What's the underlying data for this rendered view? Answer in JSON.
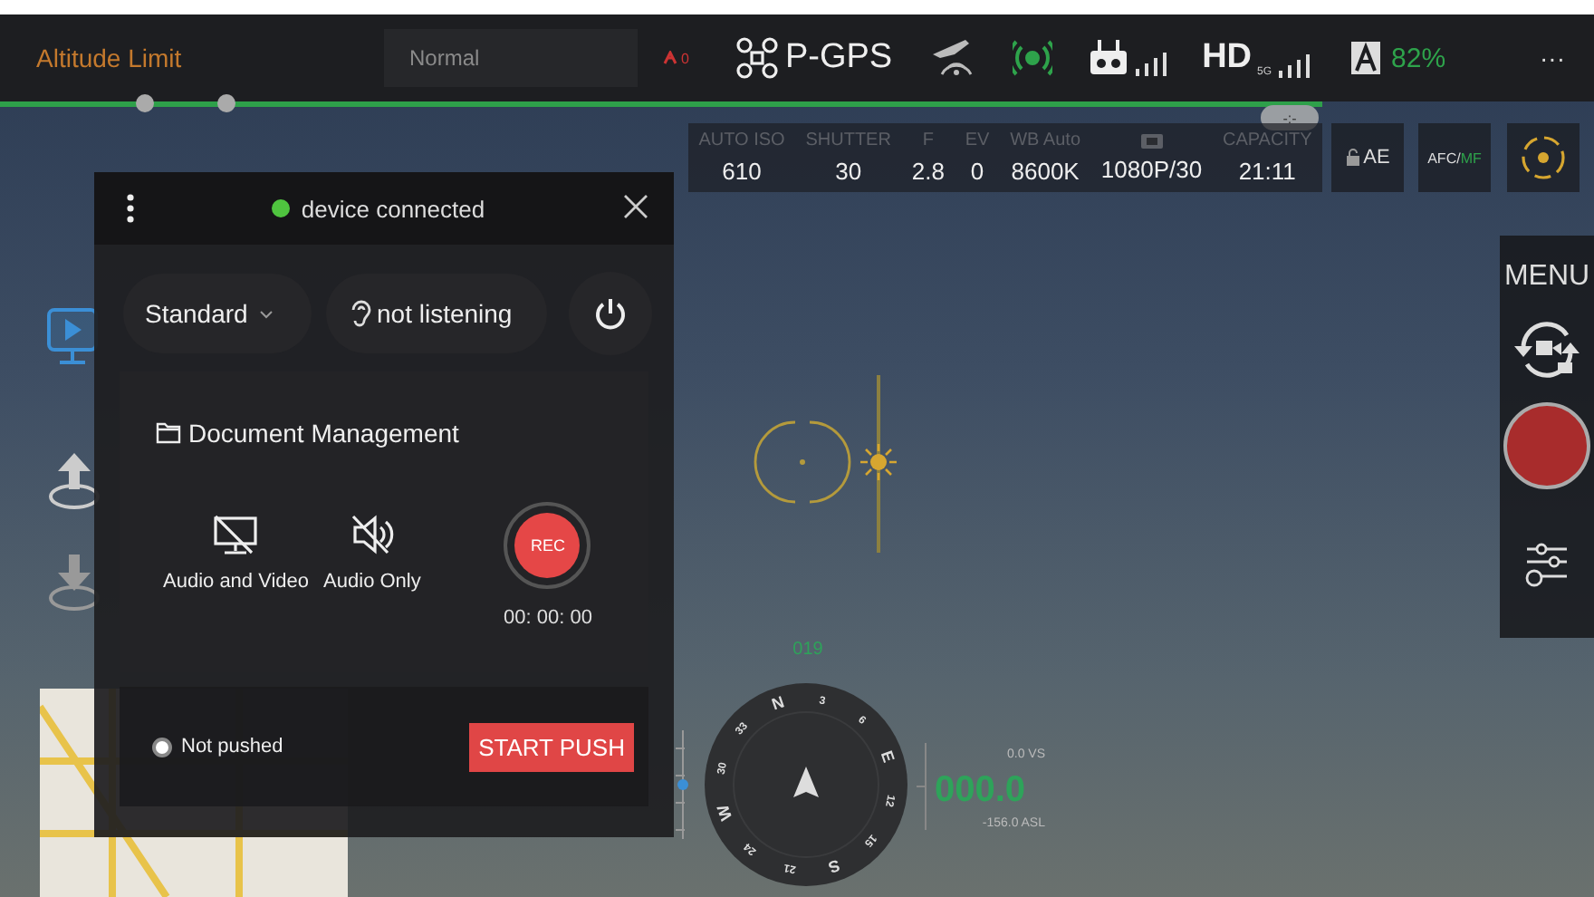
{
  "top_bar": {
    "altitude_limit": "Altitude Limit",
    "mode": "Normal",
    "warning_count": "0",
    "gps": "P-GPS",
    "hd": "HD",
    "hd_band": "5G",
    "battery": "82%",
    "more": "···"
  },
  "gimbal_indicator": "-:-",
  "camera_params": [
    {
      "kind": "text",
      "label": "AUTO ISO",
      "value": "610"
    },
    {
      "kind": "text",
      "label": "SHUTTER",
      "value": "30"
    },
    {
      "kind": "text",
      "label": "F",
      "value": "2.8"
    },
    {
      "kind": "text",
      "label": "EV",
      "value": "0"
    },
    {
      "kind": "text",
      "label": "WB Auto",
      "value": "8600K"
    },
    {
      "kind": "icon",
      "value": "1080P/30"
    },
    {
      "kind": "text",
      "label": "CAPACITY",
      "value": "21:11"
    }
  ],
  "camera_buttons": {
    "ae": "AE",
    "afc": "AFC/",
    "mf": "MF"
  },
  "right_panel": {
    "menu": "MENU"
  },
  "dialog": {
    "status": "device connected",
    "connected": true,
    "mode": "Standard",
    "listening": "not listening",
    "document": "Document Management",
    "sources": [
      {
        "kind": "video",
        "label": "Audio and Video"
      },
      {
        "kind": "audio",
        "label": "Audio Only"
      }
    ],
    "rec": "REC",
    "timer": "00: 00: 00",
    "push_status": "Not pushed",
    "push_button": "START PUSH"
  },
  "flight": {
    "heading": "019",
    "compass": [
      "N",
      "3",
      "6",
      "E",
      "12",
      "15",
      "S",
      "21",
      "24",
      "W",
      "30",
      "33"
    ],
    "vs": "0.0 VS",
    "alt": "000.0",
    "asl": "-156.0 ASL"
  }
}
